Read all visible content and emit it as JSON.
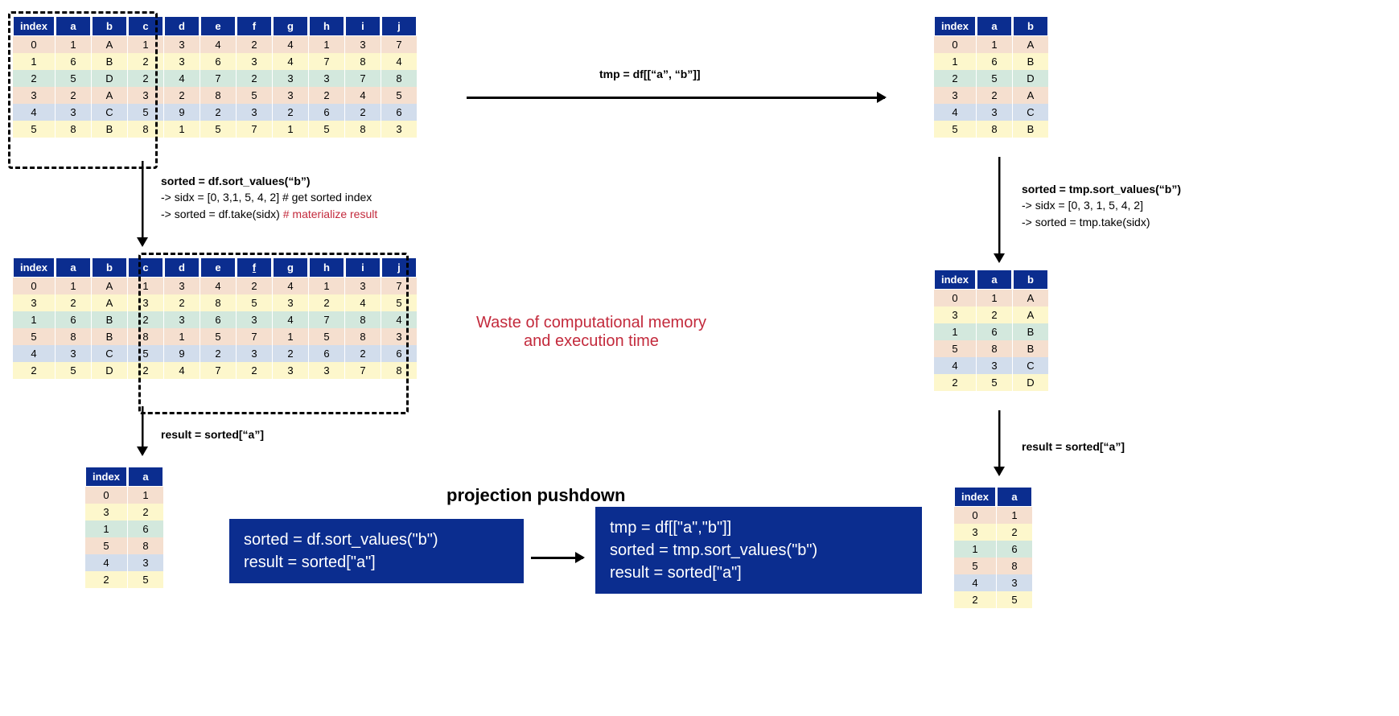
{
  "columns_full": [
    "index",
    "a",
    "b",
    "c",
    "d",
    "e",
    "f",
    "g",
    "h",
    "i",
    "j"
  ],
  "columns_ab": [
    "index",
    "a",
    "b"
  ],
  "columns_ia": [
    "index",
    "a"
  ],
  "table_full_unsorted": [
    [
      0,
      1,
      "A",
      1,
      3,
      4,
      2,
      4,
      1,
      3,
      7
    ],
    [
      1,
      6,
      "B",
      2,
      3,
      6,
      3,
      4,
      7,
      8,
      4
    ],
    [
      2,
      5,
      "D",
      2,
      4,
      7,
      2,
      3,
      3,
      7,
      8
    ],
    [
      3,
      2,
      "A",
      3,
      2,
      8,
      5,
      3,
      2,
      4,
      5
    ],
    [
      4,
      3,
      "C",
      5,
      9,
      2,
      3,
      2,
      6,
      2,
      6
    ],
    [
      5,
      8,
      "B",
      8,
      1,
      5,
      7,
      1,
      5,
      8,
      3
    ]
  ],
  "table_full_sorted": [
    [
      0,
      1,
      "A",
      1,
      3,
      4,
      2,
      4,
      1,
      3,
      7
    ],
    [
      3,
      2,
      "A",
      3,
      2,
      8,
      5,
      3,
      2,
      4,
      5
    ],
    [
      1,
      6,
      "B",
      2,
      3,
      6,
      3,
      4,
      7,
      8,
      4
    ],
    [
      5,
      8,
      "B",
      8,
      1,
      5,
      7,
      1,
      5,
      8,
      3
    ],
    [
      4,
      3,
      "C",
      5,
      9,
      2,
      3,
      2,
      6,
      2,
      6
    ],
    [
      2,
      5,
      "D",
      2,
      4,
      7,
      2,
      3,
      3,
      7,
      8
    ]
  ],
  "table_ab_unsorted": [
    [
      0,
      1,
      "A"
    ],
    [
      1,
      6,
      "B"
    ],
    [
      2,
      5,
      "D"
    ],
    [
      3,
      2,
      "A"
    ],
    [
      4,
      3,
      "C"
    ],
    [
      5,
      8,
      "B"
    ]
  ],
  "table_ab_sorted": [
    [
      0,
      1,
      "A"
    ],
    [
      3,
      2,
      "A"
    ],
    [
      1,
      6,
      "B"
    ],
    [
      5,
      8,
      "B"
    ],
    [
      4,
      3,
      "C"
    ],
    [
      2,
      5,
      "D"
    ]
  ],
  "table_ia": [
    [
      0,
      1
    ],
    [
      3,
      2
    ],
    [
      1,
      6
    ],
    [
      5,
      8
    ],
    [
      4,
      3
    ],
    [
      2,
      5
    ]
  ],
  "tmp_label": "tmp = df[[“a”, “b”]]",
  "sort_anno_left": {
    "line1": "sorted = df.sort_values(“b”)",
    "line2": "-> sidx = [0, 3,1, 5, 4, 2] # get sorted index",
    "line3_a": "-> sorted = df.take(sidx) ",
    "line3_b": "# materialize result"
  },
  "result_label_left": "result = sorted[“a”]",
  "sort_anno_right": {
    "line1": "sorted = tmp.sort_values(“b”)",
    "line2": "-> sidx = [0, 3, 1, 5, 4, 2]",
    "line3": "-> sorted = tmp.take(sidx)"
  },
  "result_label_right": "result = sorted[“a”]",
  "waste_line1": "Waste of computational memory",
  "waste_line2": "and execution time",
  "headline": "projection pushdown",
  "codebox_left_l1": "sorted = df.sort_values(\"b\")",
  "codebox_left_l2": "result = sorted[\"a\"]",
  "codebox_right_l1": "tmp = df[[\"a\",\"b\"]]",
  "codebox_right_l2": "sorted = tmp.sort_values(\"b\")",
  "codebox_right_l3": "result = sorted[\"a\"]"
}
